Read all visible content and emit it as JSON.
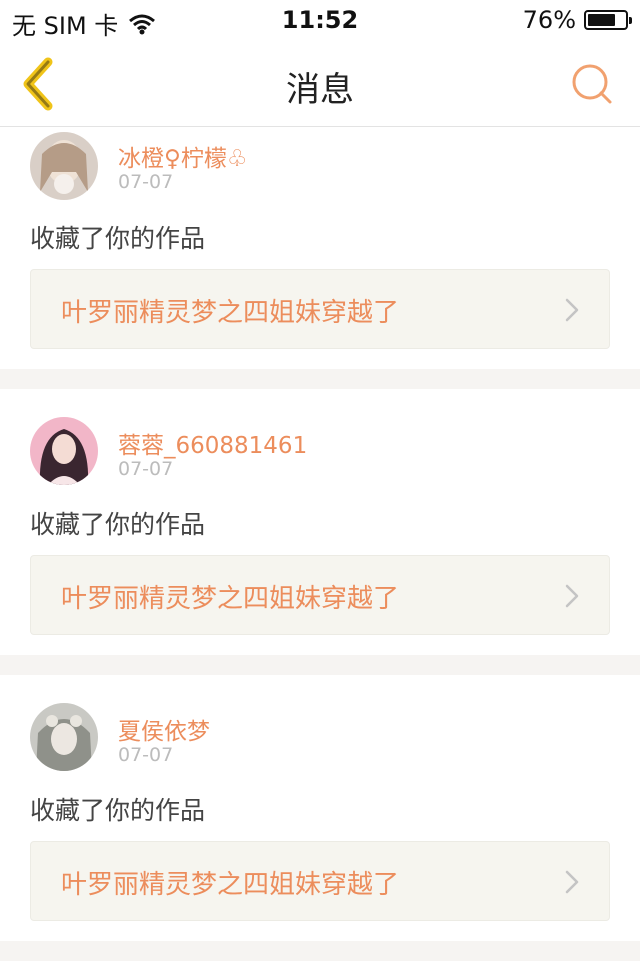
{
  "status_bar": {
    "carrier": "无 SIM 卡",
    "time": "11:52",
    "battery": "76%",
    "battery_level": 0.76
  },
  "nav": {
    "title": "消息",
    "back_icon": "chevron-left-icon",
    "search_icon": "search-icon"
  },
  "colors": {
    "accent": "#ec8d5c",
    "back_arrow": "#f0c419"
  },
  "messages": [
    {
      "username": "冰橙♀柠檬♧",
      "date": "07-07",
      "action": "收藏了你的作品",
      "work_title": "叶罗丽精灵梦之四姐妹穿越了"
    },
    {
      "username": "蓉蓉_660881461",
      "date": "07-07",
      "action": "收藏了你的作品",
      "work_title": "叶罗丽精灵梦之四姐妹穿越了"
    },
    {
      "username": "夏侯依梦",
      "date": "07-07",
      "action": "收藏了你的作品",
      "work_title": "叶罗丽精灵梦之四姐妹穿越了"
    }
  ]
}
